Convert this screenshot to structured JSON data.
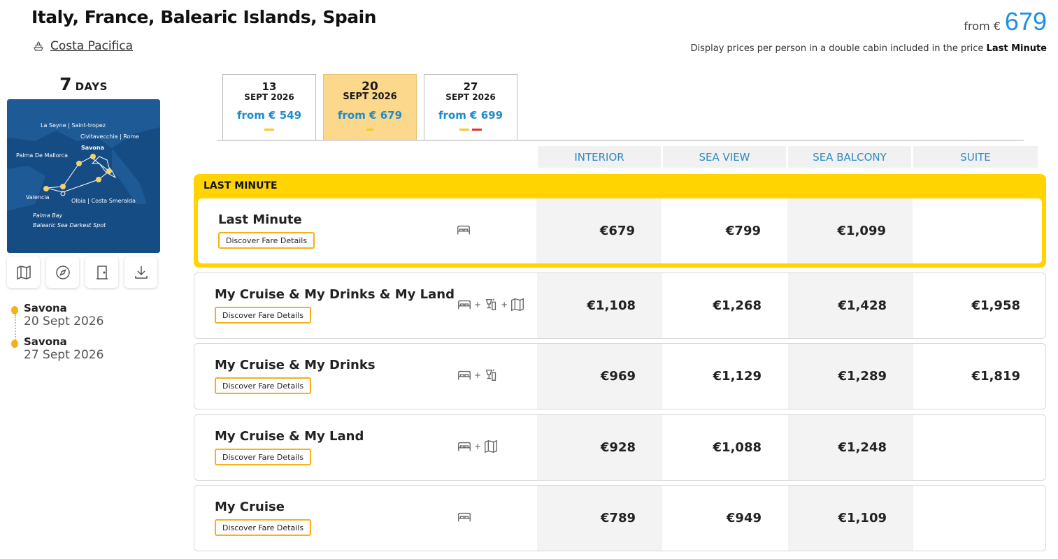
{
  "header": {
    "title": "Italy, France, Balearic Islands, Spain",
    "ship_name": "Costa Pacifica",
    "from_label": "from €",
    "from_amount": "679",
    "price_note_prefix": "Display prices per person in a double cabin included in the price",
    "price_note_bold": "Last Minute"
  },
  "itinerary": {
    "days_number": "7",
    "days_label": "DAYS",
    "map_labels": [
      "La Seyne | Saint-tropez",
      "Civitavecchia | Rome",
      "Savona",
      "Palma De Mallorca",
      "Valencia",
      "Olbia | Costa Smeralda",
      "Palma Bay",
      "Balearic Sea Darkest Spot"
    ],
    "tools": [
      "map-icon",
      "compass-icon",
      "door-icon",
      "download-icon"
    ],
    "stops": [
      {
        "port": "Savona",
        "date": "20 Sept 2026"
      },
      {
        "port": "Savona",
        "date": "27 Sept 2026"
      }
    ]
  },
  "date_tabs": [
    {
      "day": "13",
      "month": "SEPT 2026",
      "price": "from € 549",
      "active": false
    },
    {
      "day": "20",
      "month": "SEPT 2026",
      "price": "from € 679",
      "active": true
    },
    {
      "day": "27",
      "month": "SEPT 2026",
      "price": "from € 699",
      "active": false
    }
  ],
  "columns": [
    "INTERIOR",
    "SEA VIEW",
    "SEA BALCONY",
    "SUITE"
  ],
  "last_minute_label": "LAST MINUTE",
  "discover_label": "Discover Fare Details",
  "fares": [
    {
      "name": "Last Minute",
      "prices": [
        "€679",
        "€799",
        "€1,099",
        ""
      ]
    },
    {
      "name": "My Cruise & My Drinks & My Land",
      "prices": [
        "€1,108",
        "€1,268",
        "€1,428",
        "€1,958"
      ]
    },
    {
      "name": "My Cruise & My Drinks",
      "prices": [
        "€969",
        "€1,129",
        "€1,289",
        "€1,819"
      ]
    },
    {
      "name": "My Cruise & My Land",
      "prices": [
        "€928",
        "€1,088",
        "€1,248",
        ""
      ]
    },
    {
      "name": "My Cruise",
      "prices": [
        "€789",
        "€949",
        "€1,109",
        ""
      ]
    }
  ],
  "colors": {
    "accent_blue": "#1f8fe0",
    "last_minute_yellow": "#ffd400",
    "button_border": "#f5b01a"
  }
}
